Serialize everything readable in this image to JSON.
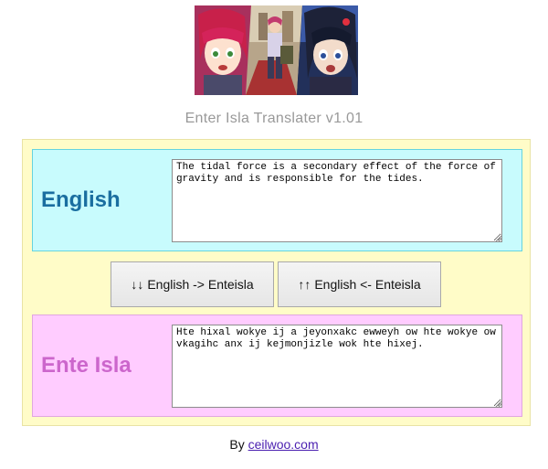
{
  "app": {
    "title": "Enter Isla Translater v1.01"
  },
  "english": {
    "label": "English",
    "text": "The tidal force is a secondary effect of the force of gravity and is responsible for the tides.",
    "color": "#1a6ea0",
    "background": "#c8fbfd"
  },
  "buttons": {
    "to_enteisla": {
      "icon": "↓↓",
      "label": "English -> Enteisla"
    },
    "to_english": {
      "icon": "↑↑",
      "label": "English <- Enteisla"
    }
  },
  "enteisla": {
    "label": "Ente Isla",
    "text": "Hte hixal wokye ij a jeyonxakc ewweyh ow hte wokye ow vkagihc anx ij kejmonjizle wok hte hixej.",
    "color": "#cc66cc",
    "background": "#ffccff"
  },
  "footer": {
    "prefix": "By",
    "link_text": "ceilwoo.com"
  },
  "icons": {
    "banner": "anime-characters-banner-image",
    "resize": "resize-grip-icon"
  }
}
